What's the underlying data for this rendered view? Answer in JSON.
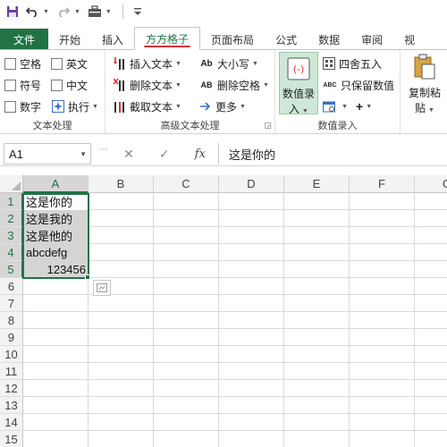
{
  "quick_access": {
    "icons": [
      "save-icon",
      "undo-icon",
      "redo-icon",
      "toolbox-icon",
      "customize-icon"
    ]
  },
  "tabs": [
    {
      "label": "文件"
    },
    {
      "label": "开始"
    },
    {
      "label": "插入"
    },
    {
      "label": "方方格子"
    },
    {
      "label": "页面布局"
    },
    {
      "label": "公式"
    },
    {
      "label": "数据"
    },
    {
      "label": "审阅"
    },
    {
      "label": "视"
    }
  ],
  "ribbon": {
    "text_group": {
      "items": [
        "空格",
        "英文",
        "符号",
        "中文",
        "数字",
        "执行"
      ],
      "label": "文本处理"
    },
    "advanced_group": {
      "insert_text": "插入文本",
      "delete_text": "删除文本",
      "extract_text": "截取文本",
      "case_label": "大小写",
      "case_icon_text": "Ab",
      "delete_space": "删除空格",
      "delete_space_icon_text": "AB",
      "more": "更多",
      "label": "高级文本处理"
    },
    "number_group": {
      "entry_button": [
        "数值录",
        "入"
      ],
      "round": "四舍五入",
      "keep_values": "只保留数值",
      "keep_values_icon_text": "ABC",
      "plus": "+",
      "label": "数值录入"
    },
    "paste_group": {
      "label": [
        "复制粘",
        "贴"
      ]
    }
  },
  "formula_bar": {
    "name_box": "A1",
    "cancel_symbol": "✕",
    "enter_symbol": "✓",
    "fx": "fx",
    "content": "这是你的"
  },
  "sheet": {
    "columns": [
      "A",
      "B",
      "C",
      "D",
      "E",
      "F",
      "G"
    ],
    "rows": [
      "1",
      "2",
      "3",
      "4",
      "5",
      "6",
      "7",
      "8",
      "9",
      "10",
      "11",
      "12",
      "13",
      "14",
      "15"
    ],
    "cells_a": [
      "这是你的",
      "这是我的",
      "这是他的",
      "abcdefg",
      "123456"
    ],
    "selected_column": "A",
    "selected_rows": [
      "1",
      "2",
      "3",
      "4",
      "5"
    ]
  }
}
